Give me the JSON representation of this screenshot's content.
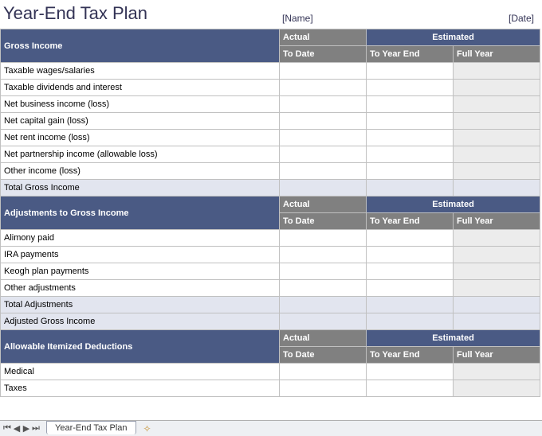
{
  "title": "Year-End Tax Plan",
  "name_placeholder": "[Name]",
  "date_placeholder": "[Date]",
  "headers": {
    "actual": "Actual",
    "estimated": "Estimated",
    "to_date": "To Date",
    "to_year_end": "To Year End",
    "full_year": "Full Year"
  },
  "sections": [
    {
      "title": "Gross Income",
      "rows": [
        {
          "label": "Taxable wages/salaries",
          "actual_to_date": "",
          "est_to_year_end": "",
          "full_year": ""
        },
        {
          "label": "Taxable dividends and interest",
          "actual_to_date": "",
          "est_to_year_end": "",
          "full_year": ""
        },
        {
          "label": "Net business income (loss)",
          "actual_to_date": "",
          "est_to_year_end": "",
          "full_year": ""
        },
        {
          "label": "Net capital gain (loss)",
          "actual_to_date": "",
          "est_to_year_end": "",
          "full_year": ""
        },
        {
          "label": "Net rent income (loss)",
          "actual_to_date": "",
          "est_to_year_end": "",
          "full_year": ""
        },
        {
          "label": "Net partnership income (allowable loss)",
          "actual_to_date": "",
          "est_to_year_end": "",
          "full_year": ""
        },
        {
          "label": "Other income (loss)",
          "actual_to_date": "",
          "est_to_year_end": "",
          "full_year": ""
        }
      ],
      "totals": [
        {
          "label": "Total Gross Income",
          "actual_to_date": "",
          "est_to_year_end": "",
          "full_year": ""
        }
      ]
    },
    {
      "title": "Adjustments to Gross Income",
      "rows": [
        {
          "label": "Alimony paid",
          "actual_to_date": "",
          "est_to_year_end": "",
          "full_year": ""
        },
        {
          "label": "IRA payments",
          "actual_to_date": "",
          "est_to_year_end": "",
          "full_year": ""
        },
        {
          "label": "Keogh plan payments",
          "actual_to_date": "",
          "est_to_year_end": "",
          "full_year": ""
        },
        {
          "label": "Other adjustments",
          "actual_to_date": "",
          "est_to_year_end": "",
          "full_year": ""
        }
      ],
      "totals": [
        {
          "label": "Total Adjustments",
          "actual_to_date": "",
          "est_to_year_end": "",
          "full_year": ""
        },
        {
          "label": "Adjusted Gross Income",
          "actual_to_date": "",
          "est_to_year_end": "",
          "full_year": ""
        }
      ]
    },
    {
      "title": "Allowable Itemized Deductions",
      "rows": [
        {
          "label": "Medical",
          "actual_to_date": "",
          "est_to_year_end": "",
          "full_year": ""
        },
        {
          "label": "Taxes",
          "actual_to_date": "",
          "est_to_year_end": "",
          "full_year": ""
        }
      ],
      "totals": []
    }
  ],
  "sheet_tab": "Year-End Tax Plan"
}
